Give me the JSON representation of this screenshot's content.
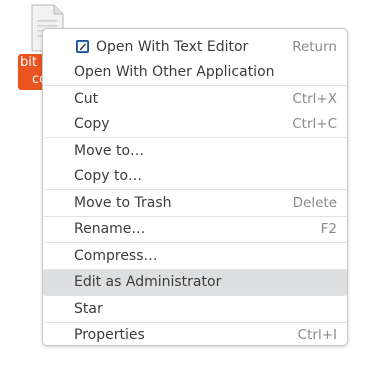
{
  "desktop": {
    "file_name_line1": "bit",
    "file_name_line2": "co"
  },
  "menu": {
    "groups": [
      [
        {
          "label": "Open With Text Editor",
          "accel": "Return",
          "icon": "text-editor-icon"
        },
        {
          "label": "Open With Other Application",
          "accel": ""
        }
      ],
      [
        {
          "label": "Cut",
          "accel": "Ctrl+X"
        },
        {
          "label": "Copy",
          "accel": "Ctrl+C"
        }
      ],
      [
        {
          "label": "Move to…",
          "accel": ""
        },
        {
          "label": "Copy to…",
          "accel": ""
        }
      ],
      [
        {
          "label": "Move to Trash",
          "accel": "Delete"
        }
      ],
      [
        {
          "label": "Rename…",
          "accel": "F2"
        }
      ],
      [
        {
          "label": "Compress…",
          "accel": ""
        }
      ],
      [
        {
          "label": "Edit as Administrator",
          "accel": "",
          "highlighted": true
        }
      ],
      [
        {
          "label": "Star",
          "accel": ""
        }
      ],
      [
        {
          "label": "Properties",
          "accel": "Ctrl+I"
        }
      ]
    ]
  },
  "colors": {
    "accent": "#e95420",
    "highlight": "#dedfe0",
    "text": "#3c3c3c",
    "accel_text": "#8a8a8a"
  }
}
